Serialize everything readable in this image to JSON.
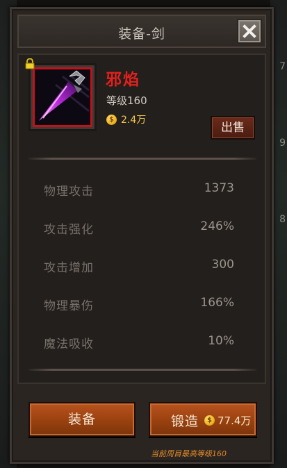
{
  "dialog": {
    "title": "装备-剑"
  },
  "background": {
    "side_numbers": [
      "7",
      "9",
      "8"
    ]
  },
  "item": {
    "name": "邪焰",
    "level": "等级160",
    "price": "2.4万",
    "locked": true,
    "rarity_color": "#c0121a"
  },
  "buttons": {
    "sell": "出售",
    "equip": "装备",
    "forge": "锻造",
    "forge_cost": "77.4万"
  },
  "stats": [
    {
      "label": "物理攻击",
      "value": "1373"
    },
    {
      "label": "攻击强化",
      "value": "246%"
    },
    {
      "label": "攻击增加",
      "value": "300"
    },
    {
      "label": "物理暴伤",
      "value": "166%"
    },
    {
      "label": "魔法吸收",
      "value": "10%"
    }
  ],
  "footer": {
    "note": "当前周目最高等级160"
  },
  "icons": {
    "coin": "gold-coin-icon",
    "coin_symbol": "$",
    "lock": "lock-icon",
    "close": "close-icon",
    "item": "sword-icon"
  },
  "colors": {
    "item_name": "#e0211d",
    "gold": "#f2c24a",
    "button": "#a8481a",
    "footnote": "#e08a2a"
  }
}
